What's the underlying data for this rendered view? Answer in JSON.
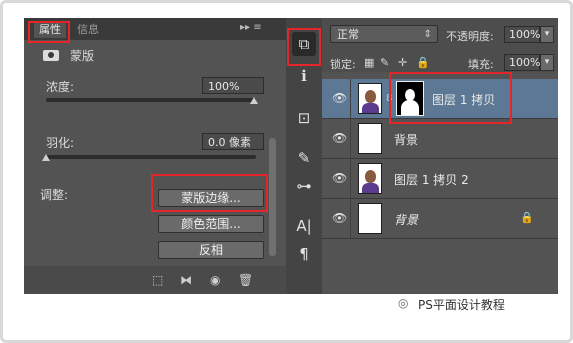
{
  "properties": {
    "tabs": [
      "属性",
      "信息"
    ],
    "tab_menu": "▸▸  ≡",
    "section_title": "蒙版",
    "density": {
      "label": "浓度:",
      "value": "100%",
      "level": 1.0
    },
    "feather": {
      "label": "羽化:",
      "value": "0.0 像素",
      "level": 0.0
    },
    "adjust_label": "调整:",
    "buttons": {
      "mask_edge": "蒙版边缘...",
      "color_range": "颜色范围...",
      "invert": "反相"
    }
  },
  "tools": {
    "icons": [
      "library-icon",
      "info-icon",
      "transform-icon",
      "brush-preset-icon",
      "adjust-icon",
      "character-icon",
      "paragraph-icon"
    ],
    "glyphs": [
      "⧉",
      "ℹ",
      "⊡",
      "✎",
      "⊶",
      "A|",
      "¶"
    ]
  },
  "layers": {
    "blend_mode": "正常",
    "opacity_label": "不透明度:",
    "opacity_value": "100%",
    "lock_label": "锁定:",
    "fill_label": "填充:",
    "fill_value": "100%",
    "items": [
      {
        "name": "图层 1 拷贝",
        "selected": true
      },
      {
        "name": "背景",
        "selected": false
      },
      {
        "name": "图层 1 拷贝 2",
        "selected": false
      },
      {
        "name": "背景",
        "selected": false
      }
    ]
  },
  "watermark": "PS平面设计教程",
  "colors": {
    "highlight": "#e3262a",
    "selected_layer": "#5c7894",
    "panel": "#535353"
  }
}
